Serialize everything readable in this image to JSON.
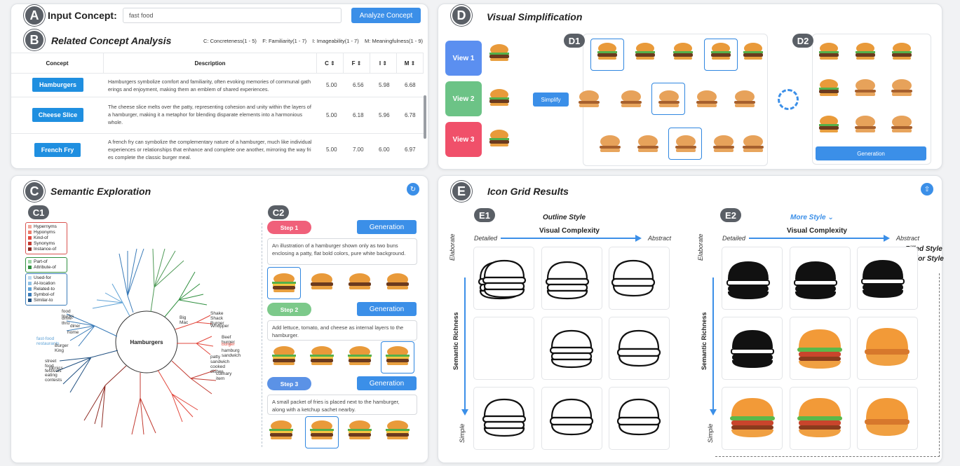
{
  "header": {
    "badge": "A",
    "label": "Input Concept:",
    "input_value": "fast food",
    "analyze_label": "Analyze Concept"
  },
  "analysis": {
    "badge": "B",
    "title": "Related Concept Analysis",
    "legend": "C: Concreteness(1 - 5)    F: Familiarity(1 - 7)    I: Imageability(1 - 7)    M: Meaningfulness(1 - 9)",
    "columns": [
      "Concept",
      "Description",
      "C",
      "F",
      "I",
      "M"
    ],
    "rows": [
      {
        "concept": "Hamburgers",
        "description": "Hamburgers symbolize comfort and familiarity, often evoking memories of communal gath erings and enjoyment, making them an emblem of shared experiences.",
        "c": "5.00",
        "f": "6.56",
        "i": "5.98",
        "m": "6.68"
      },
      {
        "concept": "Cheese Slice",
        "description": "The cheese slice melts over the patty, representing cohesion and unity within the layers of a hamburger, making it a metaphor for blending disparate elements into a harmonious whole.",
        "c": "5.00",
        "f": "6.18",
        "i": "5.96",
        "m": "6.78"
      },
      {
        "concept": "French Fry",
        "description": "A french fry can symbolize the complementary nature of a hamburger, much like individual experiences or relationships that enhance and complete one another, mirroring the way fri es complete the classic burger meal.",
        "c": "5.00",
        "f": "7.00",
        "i": "6.00",
        "m": "6.97"
      }
    ]
  },
  "semantic": {
    "badge": "C",
    "title": "Semantic Exploration",
    "c1": "C1",
    "c2": "C2",
    "center": "Hamburgers",
    "legend1": [
      "Hypernyms",
      "Hyponyms",
      "Kind-of",
      "Synonyms",
      "Instance-of"
    ],
    "legend2": [
      "Part-of",
      "Attribute-of"
    ],
    "legend3": [
      "Used-for",
      "At-location",
      "Related-to",
      "Symbol-of",
      "Similar-to"
    ],
    "steps": [
      {
        "label": "Step 1",
        "color": "#f0607a",
        "gen": "Generation",
        "prompt": "An illustration of a hamburger shown only as two buns enclosing a patty, flat bold colors, pure white background."
      },
      {
        "label": "Step 2",
        "color": "#7cc98a",
        "gen": "Generation",
        "prompt": "Add lettuce, tomato, and cheese as internal layers to the hamburger."
      },
      {
        "label": "Step 3",
        "color": "#5b92e6",
        "gen": "Generation",
        "prompt": "A small packet of fries is placed next to the hamburger, along with a ketchup sachet nearby."
      }
    ]
  },
  "simplify": {
    "badge": "D",
    "title": "Visual Simplification",
    "d1": "D1",
    "d2": "D2",
    "views": [
      {
        "label": "View 1",
        "color": "#5b8ff0"
      },
      {
        "label": "View 2",
        "color": "#6cc386"
      },
      {
        "label": "View 3",
        "color": "#f0506a"
      }
    ],
    "simplify_label": "Simplify",
    "generation_label": "Generation"
  },
  "grid": {
    "badge": "E",
    "title": "Icon Grid Results",
    "e1": "E1",
    "e2": "E2",
    "e1_title": "Outline Style",
    "e2_title": "More Style",
    "detailed": "Detailed",
    "abstract": "Abstract",
    "complexity": "Visual Complexity",
    "richness": "Semantic Richness",
    "elaborate": "Elaborate",
    "simple": "Simple",
    "filled": "Filled Style",
    "color": "Color Style"
  }
}
